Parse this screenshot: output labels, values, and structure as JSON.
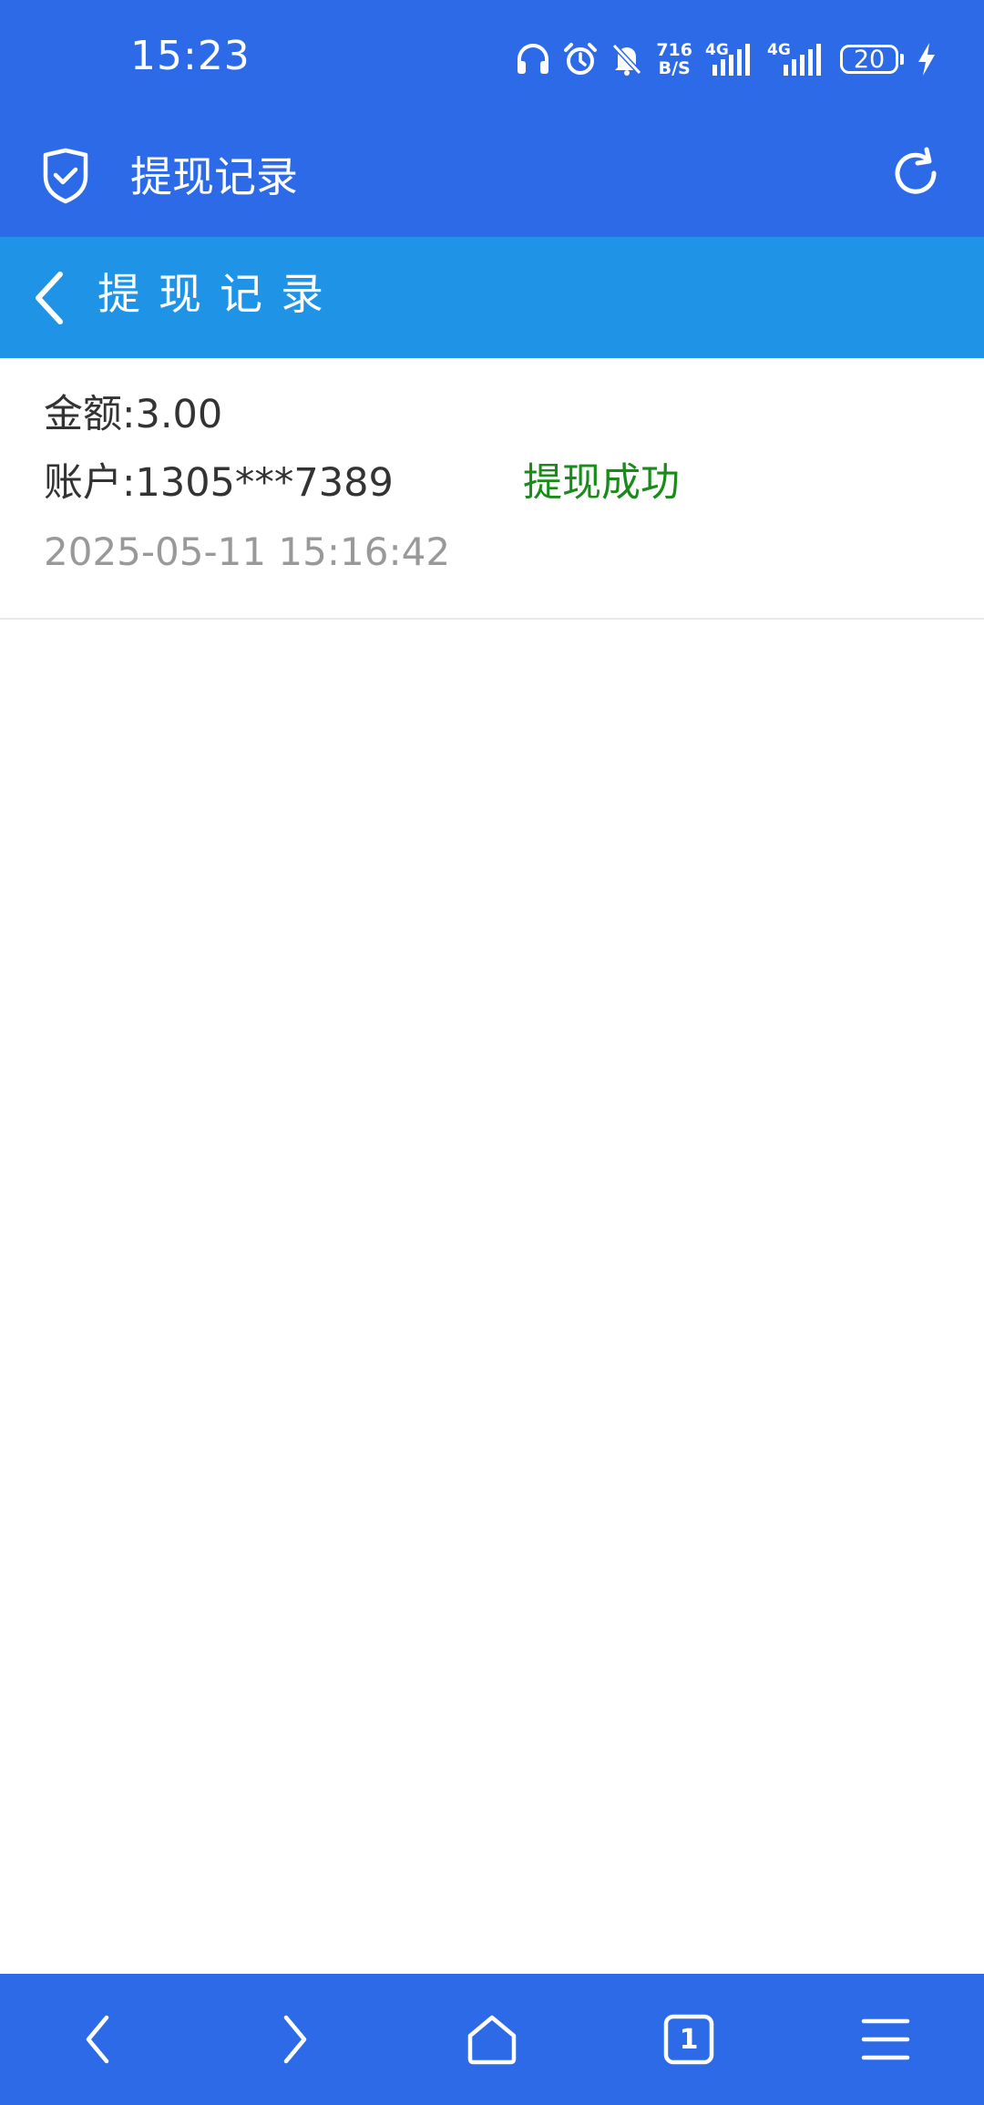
{
  "status_bar": {
    "time": "15:23",
    "net_speed_value": "716",
    "net_speed_unit": "B/S",
    "sim1_label": "4G",
    "sim2_label": "4G",
    "battery": "20",
    "icons": [
      "headphones-icon",
      "alarm-icon",
      "mute-bell-icon",
      "signal-icon",
      "signal-icon",
      "battery-icon",
      "charging-icon"
    ]
  },
  "app_bar": {
    "title": "提现记录",
    "icons": [
      "shield-check-icon",
      "refresh-icon"
    ]
  },
  "page_header": {
    "title": "提现记录",
    "icons": [
      "back-chevron-icon"
    ]
  },
  "records": [
    {
      "amount": "金额:3.00",
      "account": "账户:1305***7389",
      "status": "提现成功",
      "time": "2025-05-11 15:16:42"
    }
  ],
  "bottom_nav": {
    "tab_count": "1",
    "icons": [
      "back-arrow-icon",
      "forward-arrow-icon",
      "home-icon",
      "tabs-icon",
      "menu-icon"
    ]
  },
  "colors": {
    "app_bar": "#2c6ae8",
    "page_header": "#1f93e6",
    "status_success": "#1a8a1a"
  }
}
